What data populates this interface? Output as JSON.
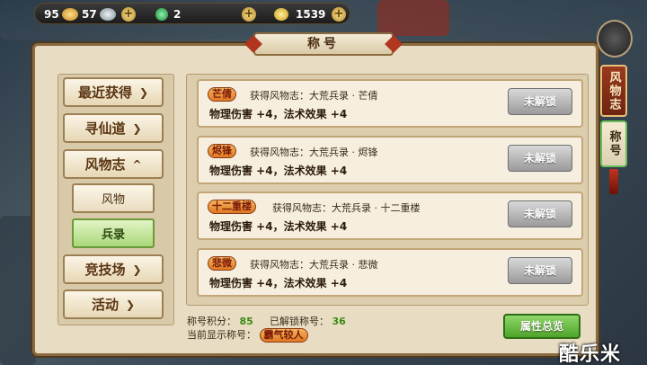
{
  "currencies": [
    {
      "value": "95",
      "color": "#e0b24a"
    },
    {
      "value": "57",
      "color": "#b8c4cc"
    },
    {
      "value": "2",
      "color": "#3fb86a"
    },
    {
      "value": "1539",
      "color": "#e5c13a"
    }
  ],
  "panel_title": "称号",
  "nav": {
    "categories": [
      {
        "label": "最近获得",
        "chevron": "chevron-down-icon"
      },
      {
        "label": "寻仙道",
        "chevron": "chevron-down-icon"
      },
      {
        "label": "风物志",
        "chevron": "chevron-up-icon"
      },
      {
        "label": "竞技场",
        "chevron": "chevron-down-icon"
      },
      {
        "label": "活动",
        "chevron": "chevron-down-icon"
      }
    ],
    "subitems": [
      {
        "label": "风物",
        "active": false
      },
      {
        "label": "兵录",
        "active": true
      }
    ]
  },
  "titles": [
    {
      "tag": "芒倩",
      "desc": "获得风物志：大荒兵录 · 芒倩",
      "stats": "物理伤害 +4，法术效果 +4",
      "button": "未解锁"
    },
    {
      "tag": "烬锋",
      "desc": "获得风物志：大荒兵录 · 烬锋",
      "stats": "物理伤害 +4，法术效果 +4",
      "button": "未解锁"
    },
    {
      "tag": "十二重楼",
      "desc": "获得风物志：大荒兵录 · 十二重楼",
      "stats": "物理伤害 +4，法术效果 +4",
      "button": "未解锁"
    },
    {
      "tag": "悲微",
      "desc": "获得风物志：大荒兵录 · 悲微",
      "stats": "物理伤害 +4，法术效果 +4",
      "button": "未解锁"
    }
  ],
  "footer": {
    "points_label": "称号积分：",
    "points_value": "85",
    "unlocked_label": "已解锁称号：",
    "unlocked_value": "36",
    "current_label": "当前显示称号：",
    "current_value": "霸气较人",
    "attr_button": "属性总览"
  },
  "side_tabs": [
    {
      "label": "风物志",
      "active": false
    },
    {
      "label": "称号",
      "active": true
    }
  ],
  "watermark": "酷乐米"
}
